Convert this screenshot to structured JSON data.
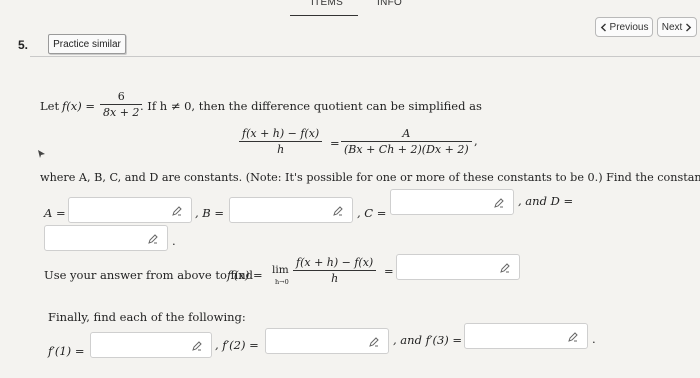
{
  "tabs": {
    "items": "ITEMS",
    "info": "INFO"
  },
  "nav": {
    "previous": "Previous",
    "next": "Next"
  },
  "question": {
    "number": "5.",
    "practice": "Practice similar"
  },
  "problem": {
    "let_text": "Let",
    "f_of_x": "f(x) =",
    "frac_num": "6",
    "frac_den": "8x + 2",
    "condition": ". If h ≠ 0, then the difference quotient can be simplified as",
    "dq_num": "f(x + h) − f(x)",
    "dq_den": "h",
    "equals": "=",
    "rhs_num": "A",
    "rhs_den": "(Bx + Ch + 2)(Dx + 2)",
    "comma": ",",
    "where_text": "where A, B, C, and D are constants. (Note: It's possible for one or more of these constants to be 0.) Find the constants.",
    "label_a": "A =",
    "label_b": ", B =",
    "label_c": ", C =",
    "label_d": ", and D =",
    "period": ".",
    "use_answer_text": "Use your answer from above to find",
    "fprime_x": "f′(x) =",
    "lim": "lim",
    "lim_sub": "h→0",
    "lim_num": "f(x + h) − f(x)",
    "lim_den": "h",
    "finally_text": "Finally, find each of the following:",
    "fp1": "f′(1) =",
    "fp2": ", f′(2) =",
    "fp3": ", and f′(3) =",
    "end_period": "."
  },
  "icons": {
    "pencil": "pencil-icon",
    "prev": "chevron-left-icon",
    "next": "chevron-right-icon"
  }
}
